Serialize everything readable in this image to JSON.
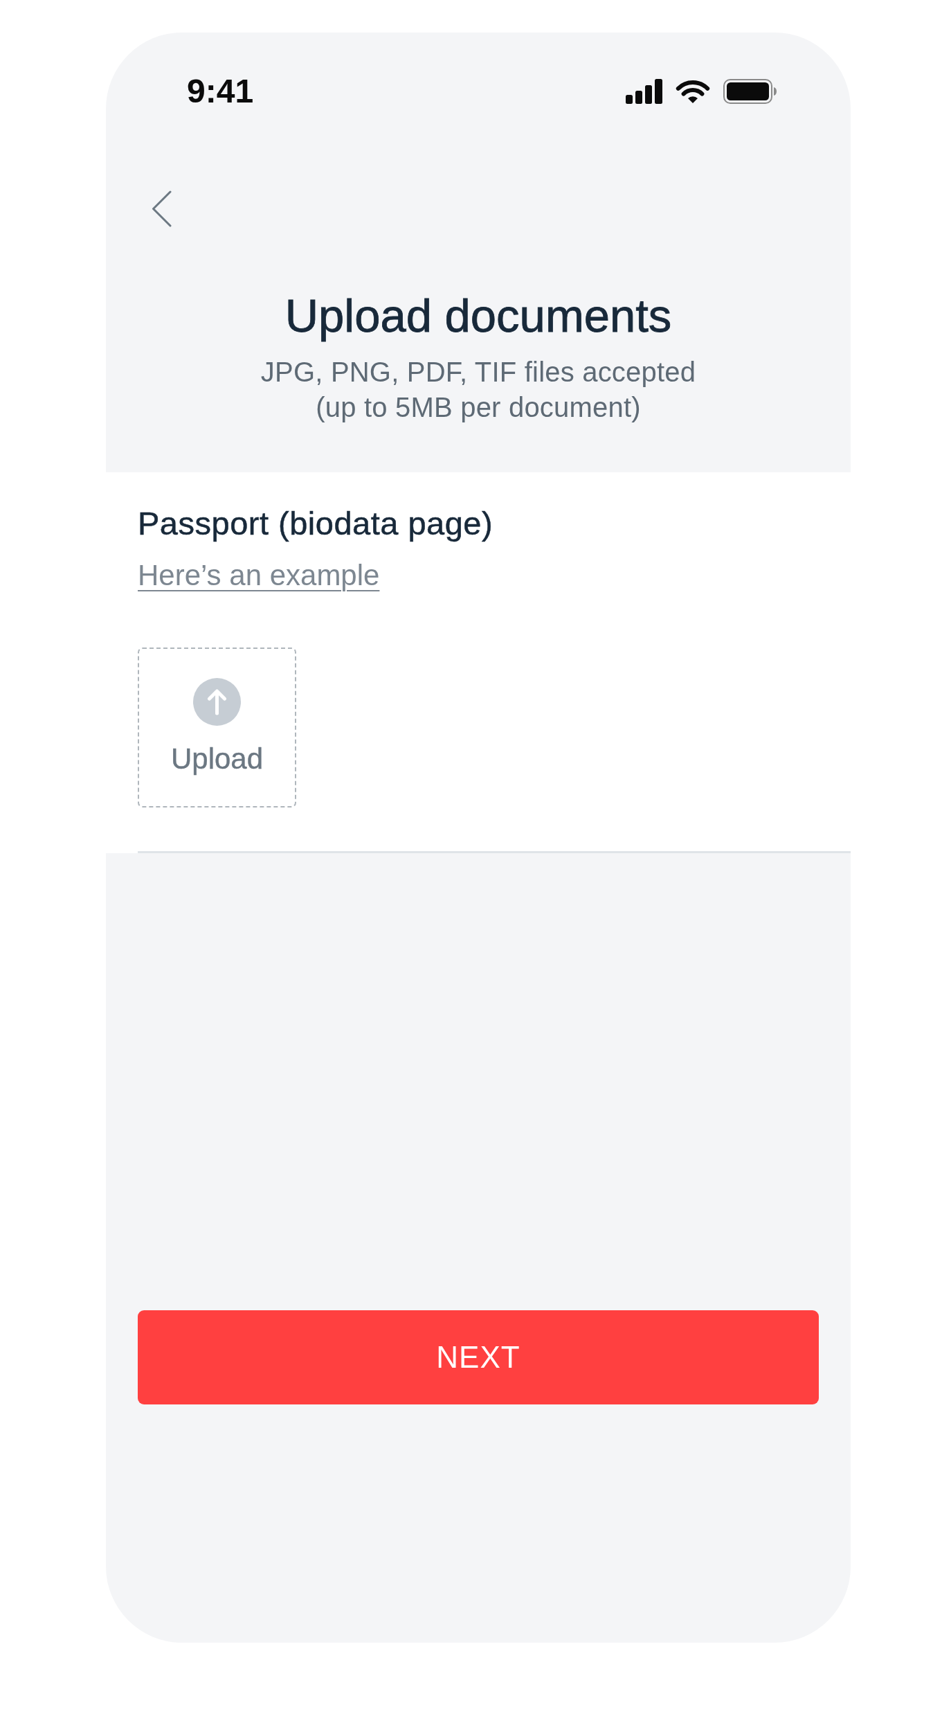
{
  "status_bar": {
    "time": "9:41"
  },
  "header": {
    "title": "Upload documents",
    "subtitle": "JPG, PNG, PDF, TIF files accepted\n(up to 5MB per document)"
  },
  "document": {
    "label": "Passport (biodata page)",
    "example_link": "Here’s an example",
    "upload_label": "Upload"
  },
  "next_button": {
    "label": "NEXT"
  }
}
